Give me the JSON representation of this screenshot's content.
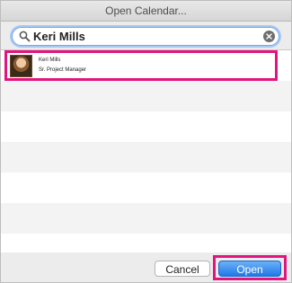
{
  "window": {
    "title": "Open Calendar..."
  },
  "search": {
    "value": "Keri Mills"
  },
  "results": [
    {
      "name": "Keri Mills",
      "title": "Sr. Project Manager"
    }
  ],
  "buttons": {
    "cancel": "Cancel",
    "open": "Open"
  },
  "colors": {
    "highlight": "#e2147d",
    "accent": "#1f7ae8"
  }
}
